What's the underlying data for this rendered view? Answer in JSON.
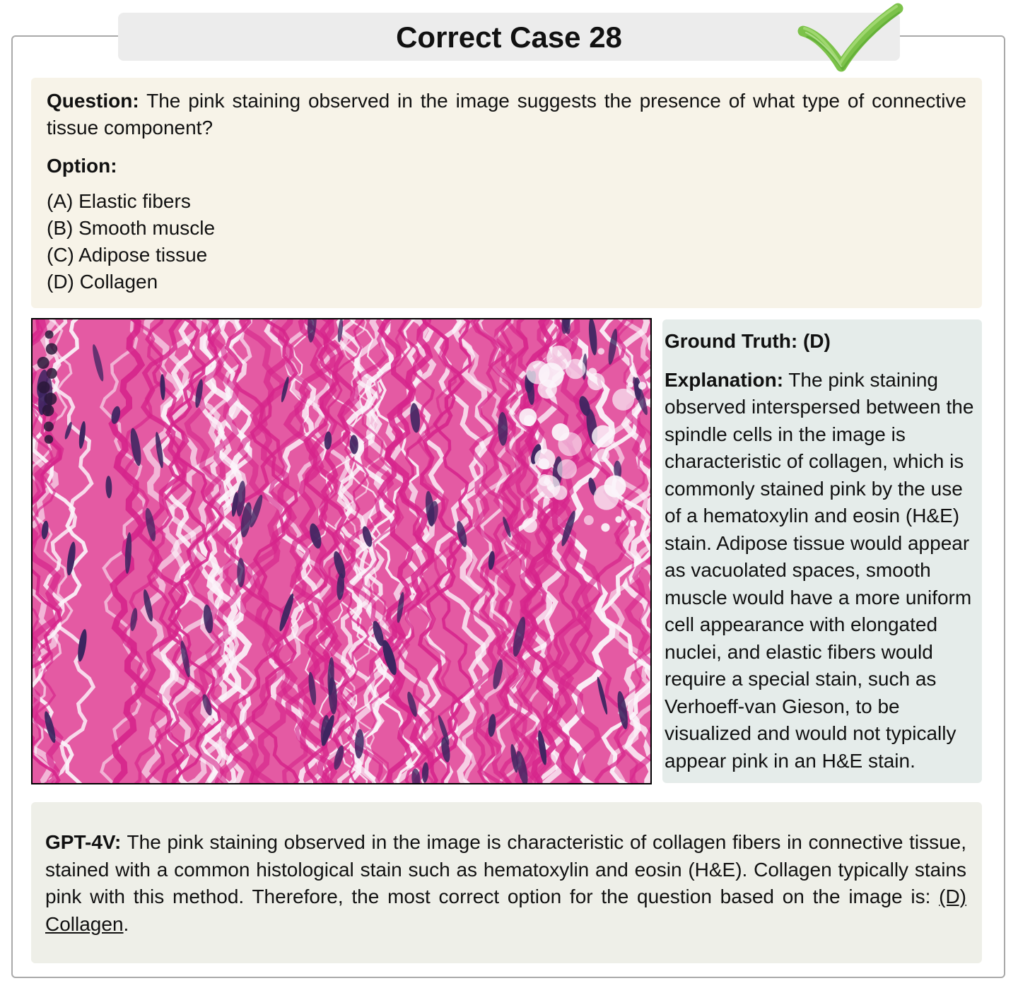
{
  "title": "Correct Case 28",
  "icons": {
    "status": "checkmark-icon",
    "status_color": "#7cc24a"
  },
  "question": {
    "label": "Question:",
    "text": "The pink staining observed in the image suggests the presence of what type of connective tissue component?",
    "options_label": "Option:",
    "options": [
      "(A) Elastic fibers",
      "(B) Smooth muscle",
      "(C) Adipose tissue",
      "(D) Collagen"
    ]
  },
  "image": {
    "alt": "Histology micrograph",
    "colors": {
      "stroma": "#e45aa3",
      "fiber": "#d6248b",
      "nuclei": "#3d2560",
      "space": "#fbf4fa"
    }
  },
  "ground_truth": {
    "label": "Ground Truth: (D)",
    "explanation_label": "Explanation:",
    "explanation_text": "The pink staining observed interspersed between the spindle cells in the image is characteristic of collagen, which is commonly stained pink by the use of a hematoxylin and eosin (H&E) stain. Adipose tissue would appear as vacuolated spaces, smooth muscle would have a more uniform cell appearance with elongated nuclei, and elastic fibers would require a special stain, such as Verhoeff-van Gieson, to be visualized and would not typically appear pink in an H&E stain."
  },
  "model": {
    "label": "GPT-4V:",
    "text": "The pink staining observed in the image is characteristic of collagen fibers in connective tissue, stained with a common histological stain such as hematoxylin and eosin (H&E). Collagen typically stains pink with this method. Therefore, the most correct option for the question based on the image is:",
    "answer": "(D) Collagen",
    "end": "."
  },
  "colors": {
    "question_bg": "#f7f3e8",
    "answer_bg": "#e5ecea",
    "model_bg": "#eeefe8",
    "title_bg": "#ececec"
  }
}
